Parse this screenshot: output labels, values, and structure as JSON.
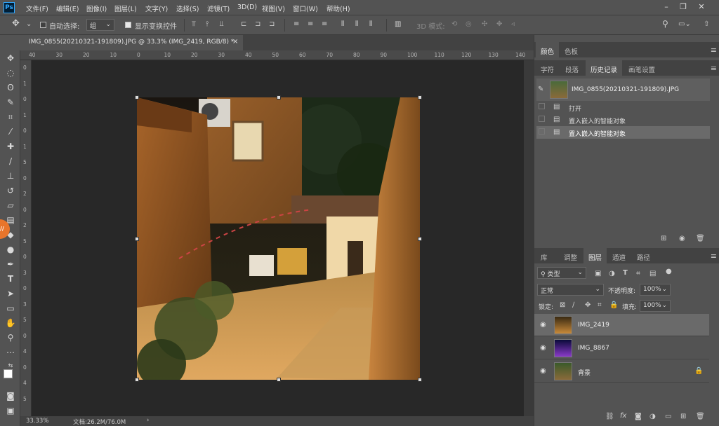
{
  "menubar": {
    "items": [
      "文件(F)",
      "编辑(E)",
      "图像(I)",
      "图层(L)",
      "文字(Y)",
      "选择(S)",
      "滤镜(T)",
      "3D(D)",
      "视图(V)",
      "窗口(W)",
      "帮助(H)"
    ]
  },
  "options": {
    "auto_select_label": "自动选择:",
    "auto_select_value": "组",
    "show_transform_label": "显示变换控件",
    "mode_3d_label": "3D 模式:"
  },
  "document": {
    "tab_title": "IMG_0855(20210321-191809).JPG @ 33.3% (IMG_2419, RGB/8) *",
    "close": "×"
  },
  "ruler_h": [
    "40",
    "30",
    "20",
    "10",
    "0",
    "10",
    "20",
    "30",
    "40",
    "50",
    "60",
    "70",
    "80",
    "90",
    "100",
    "110",
    "120",
    "130",
    "140"
  ],
  "ruler_v": [
    "0",
    "1",
    "0",
    "1",
    "0",
    "1",
    "5",
    "0",
    "2",
    "0",
    "2",
    "5",
    "0",
    "3",
    "0",
    "3",
    "5",
    "0",
    "4",
    "0",
    "4",
    "5"
  ],
  "status": {
    "zoom": "33.33%",
    "doc": "文档:26.2M/76.0M",
    "arrow": "›"
  },
  "panels": {
    "top_tabs": [
      "颜色",
      "色板"
    ],
    "mid_tabs": [
      "字符",
      "段落",
      "历史记录",
      "画笔设置"
    ],
    "history": {
      "snapshot": "IMG_0855(20210321-191809).JPG",
      "states": [
        "打开",
        "置入嵌入的智能对象",
        "置入嵌入的智能对象"
      ]
    },
    "layer_tabs": [
      "库",
      "调整",
      "图层",
      "通道",
      "路径"
    ],
    "filter_kind": "类型",
    "blend_mode": "正常",
    "opacity_label": "不透明度:",
    "opacity_value": "100%",
    "lock_label": "锁定:",
    "fill_label": "填充:",
    "fill_value": "100%",
    "layers": [
      {
        "name": "IMG_2419"
      },
      {
        "name": "IMG_8867"
      },
      {
        "name": "背景"
      }
    ],
    "fx": "fx"
  }
}
